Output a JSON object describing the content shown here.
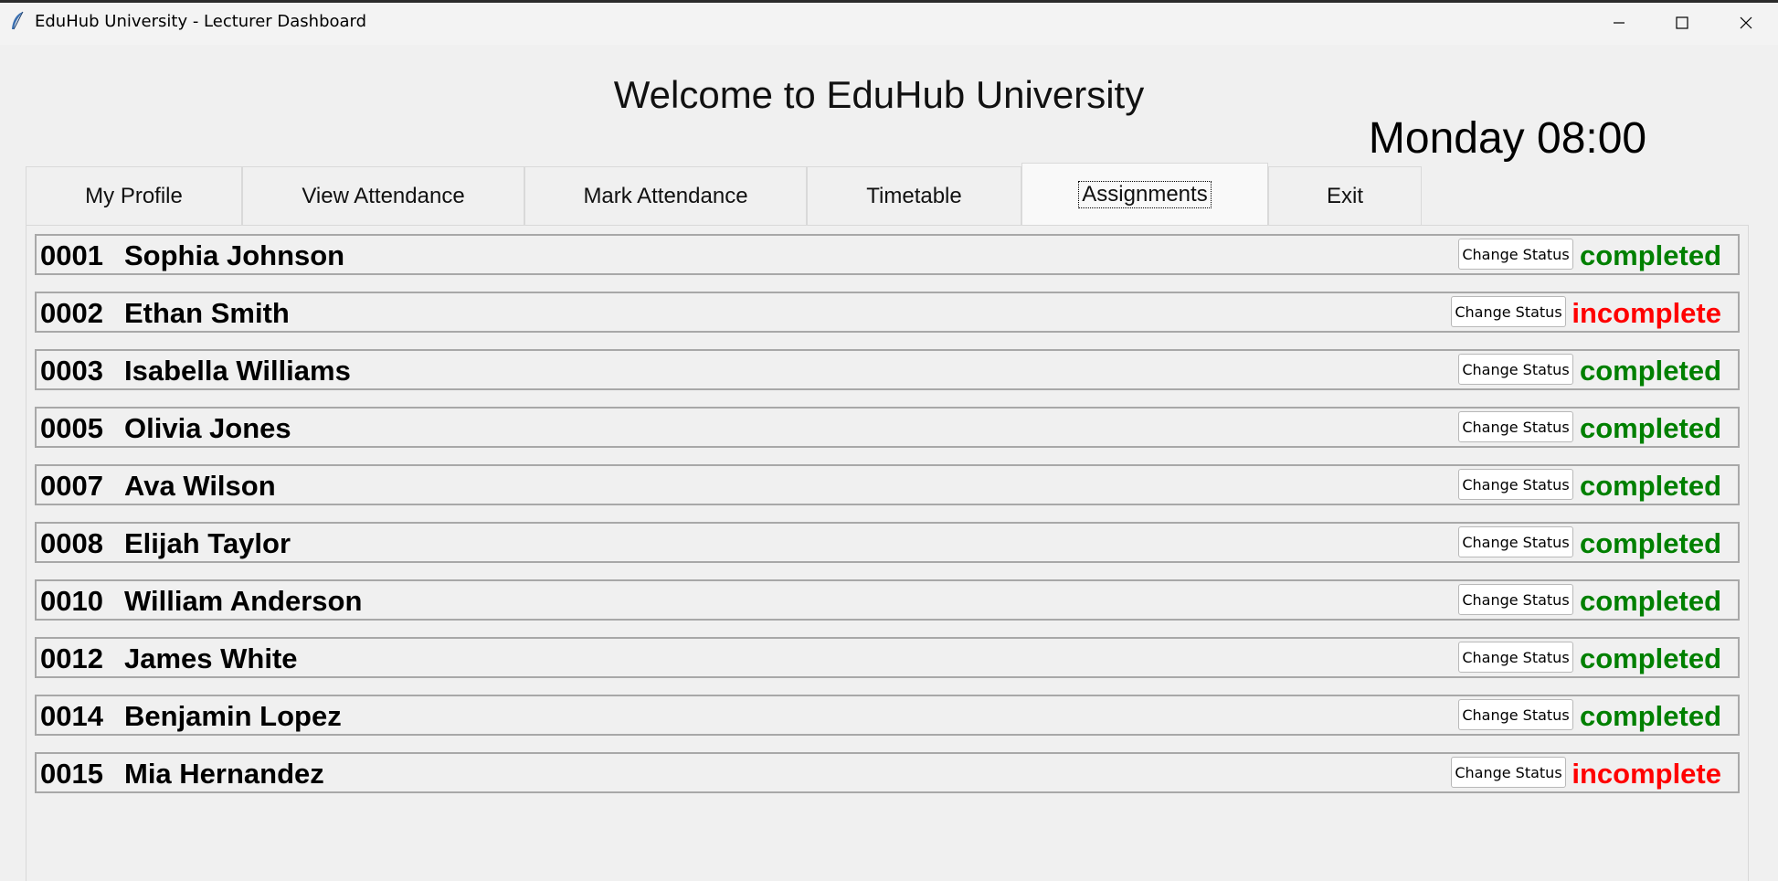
{
  "window": {
    "title": "EduHub University - Lecturer Dashboard"
  },
  "header": {
    "welcome": "Welcome to EduHub University",
    "clock": "Monday 08:00"
  },
  "tabs": [
    {
      "label": "My Profile"
    },
    {
      "label": "View Attendance"
    },
    {
      "label": "Mark Attendance"
    },
    {
      "label": "Timetable"
    },
    {
      "label": "Assignments",
      "active": true
    },
    {
      "label": "Exit"
    }
  ],
  "colors": {
    "completed": "#008000",
    "incomplete": "#ff0000"
  },
  "students": [
    {
      "id": "0001",
      "name": "Sophia Johnson",
      "button": "Change Status",
      "status": "completed"
    },
    {
      "id": "0002",
      "name": "Ethan Smith",
      "button": "Change Status",
      "status": "incomplete"
    },
    {
      "id": "0003",
      "name": "Isabella Williams",
      "button": "Change Status",
      "status": "completed"
    },
    {
      "id": "0005",
      "name": "Olivia Jones",
      "button": "Change Status",
      "status": "completed"
    },
    {
      "id": "0007",
      "name": "Ava Wilson",
      "button": "Change Status",
      "status": "completed"
    },
    {
      "id": "0008",
      "name": "Elijah Taylor",
      "button": "Change Status",
      "status": "completed"
    },
    {
      "id": "0010",
      "name": "William Anderson",
      "button": "Change Status",
      "status": "completed"
    },
    {
      "id": "0012",
      "name": "James White",
      "button": "Change Status",
      "status": "completed"
    },
    {
      "id": "0014",
      "name": "Benjamin Lopez",
      "button": "Change Status",
      "status": "completed"
    },
    {
      "id": "0015",
      "name": "Mia Hernandez",
      "button": "Change Status",
      "status": "incomplete"
    }
  ]
}
